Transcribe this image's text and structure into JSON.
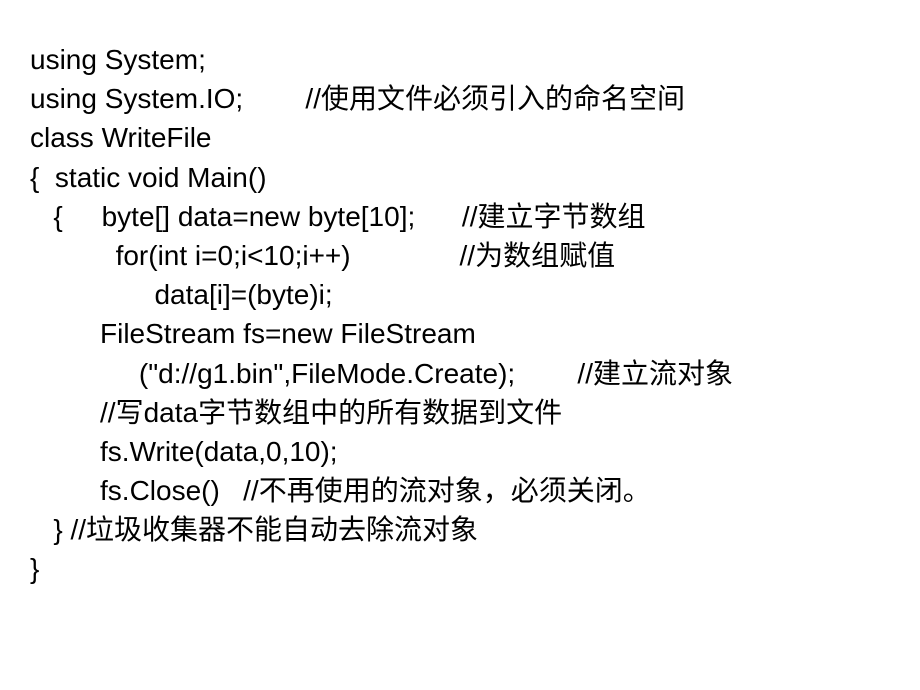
{
  "code": {
    "l1": "using System;",
    "l2a": "using System.IO;        ",
    "l2b": "//使用文件必须引入的命名空间",
    "l3": "class WriteFile",
    "l4": "{  static void Main()",
    "l5a": "   {     byte[] data=new byte[10];      ",
    "l5b": "//建立字节数组",
    "l6a": "           for(int i=0;i<10;i++)              ",
    "l6b": "//为数组赋值",
    "l7": "                data[i]=(byte)i;",
    "l8": "         FileStream fs=new FileStream",
    "l9a": "              (\"d://g1.bin\",FileMode.Create);        ",
    "l9b": "//建立流对象",
    "l10": "         //写data字节数组中的所有数据到文件",
    "l11": "         fs.Write(data,0,10);",
    "l12a": "         fs.Close()   ",
    "l12b": "//不再使用的流对象，必须关闭。",
    "l13": "   } //垃圾收集器不能自动去除流对象",
    "l14": "}"
  }
}
